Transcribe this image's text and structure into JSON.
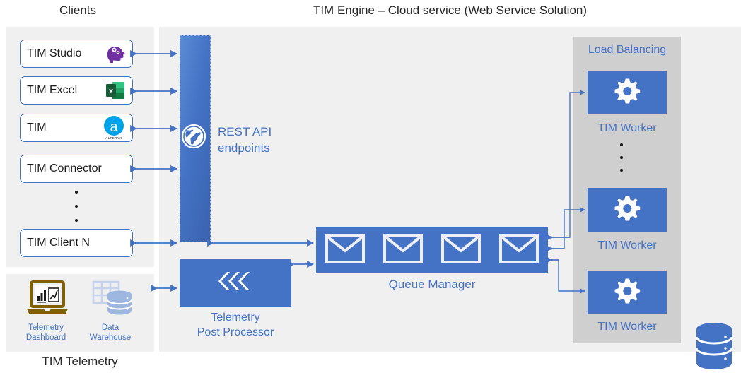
{
  "headings": {
    "clients": "Clients",
    "engine": "TIM Engine – Cloud service (Web Service Solution)",
    "telemetry": "TIM Telemetry"
  },
  "clients": {
    "items": [
      {
        "label": "TIM Studio",
        "icon": "brain-gears-icon"
      },
      {
        "label": "TIM Excel",
        "icon": "excel-icon"
      },
      {
        "label": "TIM",
        "icon": "alteryx-icon"
      },
      {
        "label": "TIM Connector",
        "icon": "none"
      },
      {
        "label": "TIM Client N",
        "icon": "none"
      }
    ],
    "ellipsis": "⋮"
  },
  "rest_api": {
    "label_line1": "REST API",
    "label_line2": "endpoints",
    "icon": "globe-icon"
  },
  "telemetry_post_processor": {
    "label_line1": "Telemetry",
    "label_line2": "Post Processor",
    "icon": "rewind-chevrons-icon"
  },
  "queue_manager": {
    "label": "Queue Manager",
    "message_count": 4,
    "icon": "envelope-icon"
  },
  "load_balancing": {
    "title": "Load Balancing",
    "workers": [
      {
        "label": "TIM Worker",
        "icon": "gear-icon"
      },
      {
        "label": "TIM Worker",
        "icon": "gear-icon"
      },
      {
        "label": "TIM Worker",
        "icon": "gear-icon"
      }
    ],
    "ellipsis": "⋮"
  },
  "telemetry": {
    "dashboard": {
      "label_line1": "Telemetry",
      "label_line2": "Dashboard",
      "icon": "laptop-chart-icon"
    },
    "data_warehouse": {
      "label_line1": "Data",
      "label_line2": "Warehouse",
      "icon": "table-database-icon"
    }
  },
  "database": {
    "icon": "database-cylinder-icon"
  },
  "colors": {
    "accent_blue": "#4472C4",
    "panel_gray": "#F0F0F0",
    "load_balancer_gray": "#CFCFCF",
    "arrow_blue": "#4472C4",
    "text_dark": "#262626",
    "excel_green": "#217346",
    "studio_purple": "#7030A0",
    "alteryx_blue": "#00A2E8",
    "laptop_gold": "#7F6000",
    "warehouse_light_blue": "#B4C7E7"
  }
}
